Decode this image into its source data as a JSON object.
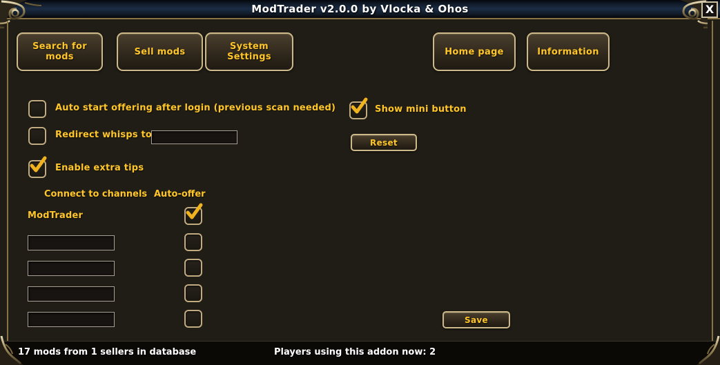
{
  "window": {
    "title": "ModTrader v2.0.0 by Vlocka & Ohos",
    "close_label": "X",
    "close_icon": "close-icon"
  },
  "toolbar": {
    "left_buttons": [
      {
        "label": "Search for mods",
        "name": "search-for-mods"
      },
      {
        "label": "Sell mods",
        "name": "sell-mods"
      },
      {
        "label": "System Settings",
        "name": "system-settings"
      }
    ],
    "right_buttons": [
      {
        "label": "Home page",
        "name": "home-page"
      },
      {
        "label": "Information",
        "name": "information"
      }
    ]
  },
  "settings": {
    "auto_start": {
      "label": "Auto start offering after login (previous scan needed)",
      "checked": false
    },
    "redirect_whisps": {
      "label": "Redirect whisps to:",
      "checked": false,
      "value": "",
      "placeholder": ""
    },
    "enable_extra_tips": {
      "label": "Enable extra tips",
      "checked": true
    },
    "show_mini_button": {
      "label": "Show mini button",
      "checked": true
    },
    "reset_label": "Reset",
    "save_label": "Save"
  },
  "channels": {
    "header_channels": "Connect to channels",
    "header_autooffer": "Auto-offer",
    "rows": [
      {
        "name": "ModTrader",
        "editable": false,
        "value": "ModTrader",
        "auto_offer": true,
        "placeholder": ""
      },
      {
        "name": "channel-2",
        "editable": true,
        "value": "",
        "auto_offer": false,
        "placeholder": ""
      },
      {
        "name": "channel-3",
        "editable": true,
        "value": "",
        "auto_offer": false,
        "placeholder": ""
      },
      {
        "name": "channel-4",
        "editable": true,
        "value": "",
        "auto_offer": false,
        "placeholder": ""
      },
      {
        "name": "channel-5",
        "editable": true,
        "value": "",
        "auto_offer": false,
        "placeholder": ""
      }
    ]
  },
  "status": {
    "left": "17 mods from 1 sellers in database",
    "right": "Players using this addon now: 2"
  },
  "colors": {
    "accent_gold": "#ffc62a",
    "border_gold": "#cdb98a",
    "frame_gold": "#8a7444",
    "panel_bg": "#262219",
    "title_blue": "#1b2c44",
    "status_text": "#ffffff"
  }
}
